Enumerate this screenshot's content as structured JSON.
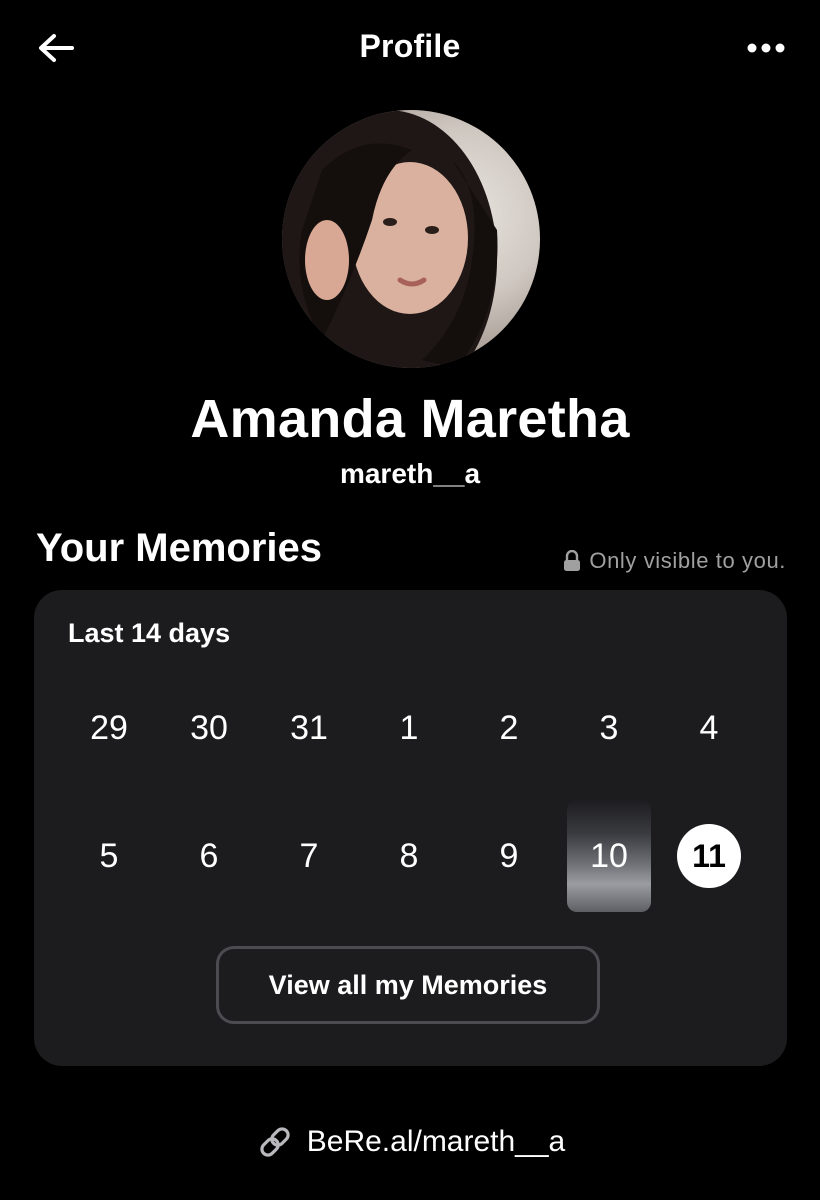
{
  "header": {
    "title": "Profile",
    "back_icon": "arrow-left-icon",
    "more_icon": "more-horizontal-icon"
  },
  "profile": {
    "name": "Amanda Maretha",
    "username": "mareth__a"
  },
  "memories": {
    "title": "Your Memories",
    "privacy_note": "Only visible to you.",
    "privacy_icon": "lock-icon",
    "range_label": "Last 14 days",
    "week1": [
      "29",
      "30",
      "31",
      "1",
      "2",
      "3",
      "4"
    ],
    "week2": [
      "5",
      "6",
      "7",
      "8",
      "9",
      "10",
      "11"
    ],
    "today": "11",
    "has_memory": [
      "10"
    ],
    "view_all_label": "View all my Memories"
  },
  "link": {
    "icon": "link-icon",
    "text": "BeRe.al/mareth__a"
  },
  "colors": {
    "background": "#000000",
    "card": "#1c1c1e",
    "muted_text": "#a0a0a0",
    "button_border": "#4b4b50"
  }
}
